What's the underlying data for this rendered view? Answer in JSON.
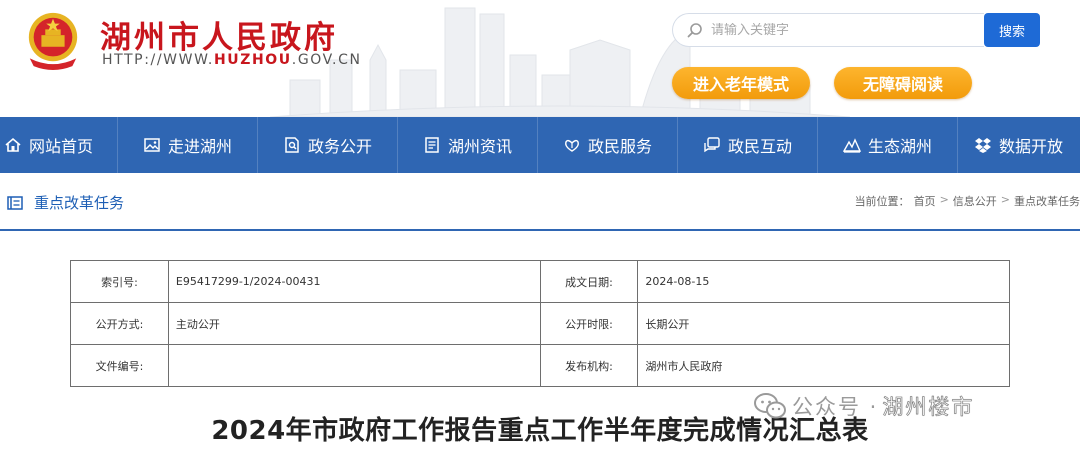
{
  "header": {
    "site_title": "湖州市人民政府",
    "site_url_prefix": "HTTP://WWW.",
    "site_url_bold": "HUZHOU",
    "site_url_suffix": ".GOV.CN",
    "brand_color": "#c8161d",
    "search": {
      "placeholder": "请输入关键字",
      "button_label": "搜索"
    },
    "elder_mode_label": "进入老年模式",
    "accessible_label": "无障碍阅读"
  },
  "nav": {
    "color": "#2f66b3",
    "items": [
      {
        "label": "网站首页",
        "icon": "home-icon"
      },
      {
        "label": "走进湖州",
        "icon": "picture-icon"
      },
      {
        "label": "政务公开",
        "icon": "document-search-icon"
      },
      {
        "label": "湖州资讯",
        "icon": "news-icon"
      },
      {
        "label": "政民服务",
        "icon": "hands-icon"
      },
      {
        "label": "政民互动",
        "icon": "chat-icon"
      },
      {
        "label": "生态湖州",
        "icon": "mountain-icon"
      },
      {
        "label": "数据开放",
        "icon": "dropbox-icon"
      }
    ]
  },
  "section": {
    "title": "重点改革任务",
    "breadcrumb_prefix": "当前位置：",
    "breadcrumb": [
      "首页",
      "信息公开",
      "重点改革任务"
    ],
    "breadcrumb_sep": ">"
  },
  "info": {
    "rows": [
      {
        "l1": "索引号:",
        "v1": "E95417299-1/2024-00431",
        "l2": "成文日期:",
        "v2": "2024-08-15"
      },
      {
        "l1": "公开方式:",
        "v1": "主动公开",
        "l2": "公开时限:",
        "v2": "长期公开"
      },
      {
        "l1": "文件编号:",
        "v1": "",
        "l2": "发布机构:",
        "v2": "湖州市人民政府"
      }
    ]
  },
  "article": {
    "title": "2024年市政府工作报告重点工作半年度完成情况汇总表"
  },
  "watermark": {
    "prefix": "公众号 · ",
    "name": "湖州楼市"
  }
}
